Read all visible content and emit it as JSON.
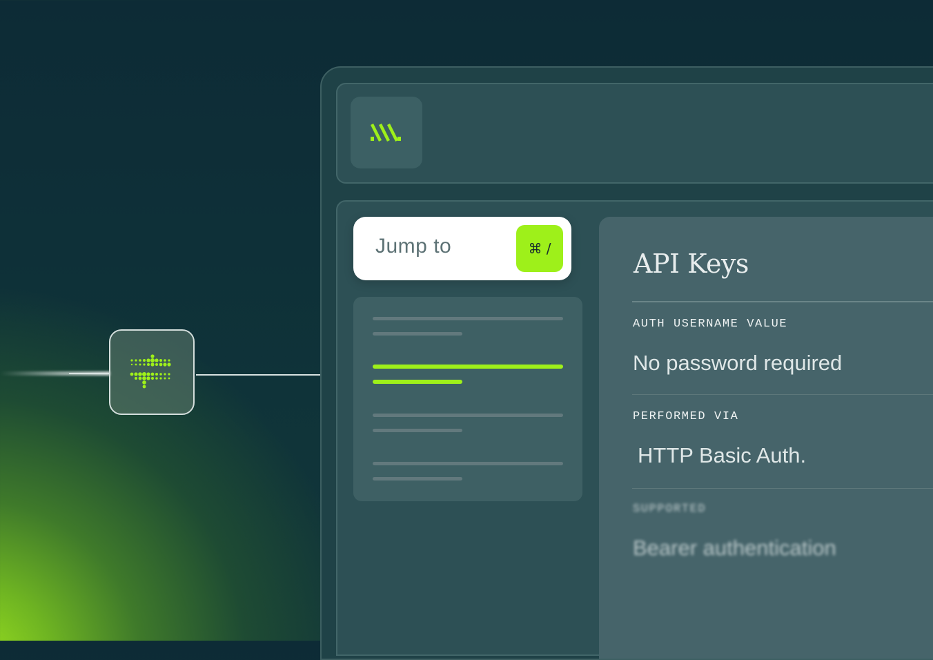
{
  "colors": {
    "accent": "#9ef01a",
    "background": "#0d2b36",
    "panel": "#2d5055",
    "detail_panel": "#46646a"
  },
  "node": {
    "icon": "waveform-dots-icon"
  },
  "header": {
    "logo_icon": "slanted-stripes-logo-icon"
  },
  "search": {
    "label": "Jump to",
    "shortcut": "⌘ /"
  },
  "nav": {
    "items": [
      {
        "state": "inactive"
      },
      {
        "state": "active"
      },
      {
        "state": "inactive"
      },
      {
        "state": "inactive"
      }
    ]
  },
  "detail": {
    "title": "API Keys",
    "fields": [
      {
        "label": "AUTH USERNAME VALUE",
        "value": "No password required"
      },
      {
        "label": "PERFORMED VIA",
        "value": "HTTP Basic Auth."
      },
      {
        "label": "SUPPORTED",
        "value": "Bearer authentication"
      }
    ]
  }
}
